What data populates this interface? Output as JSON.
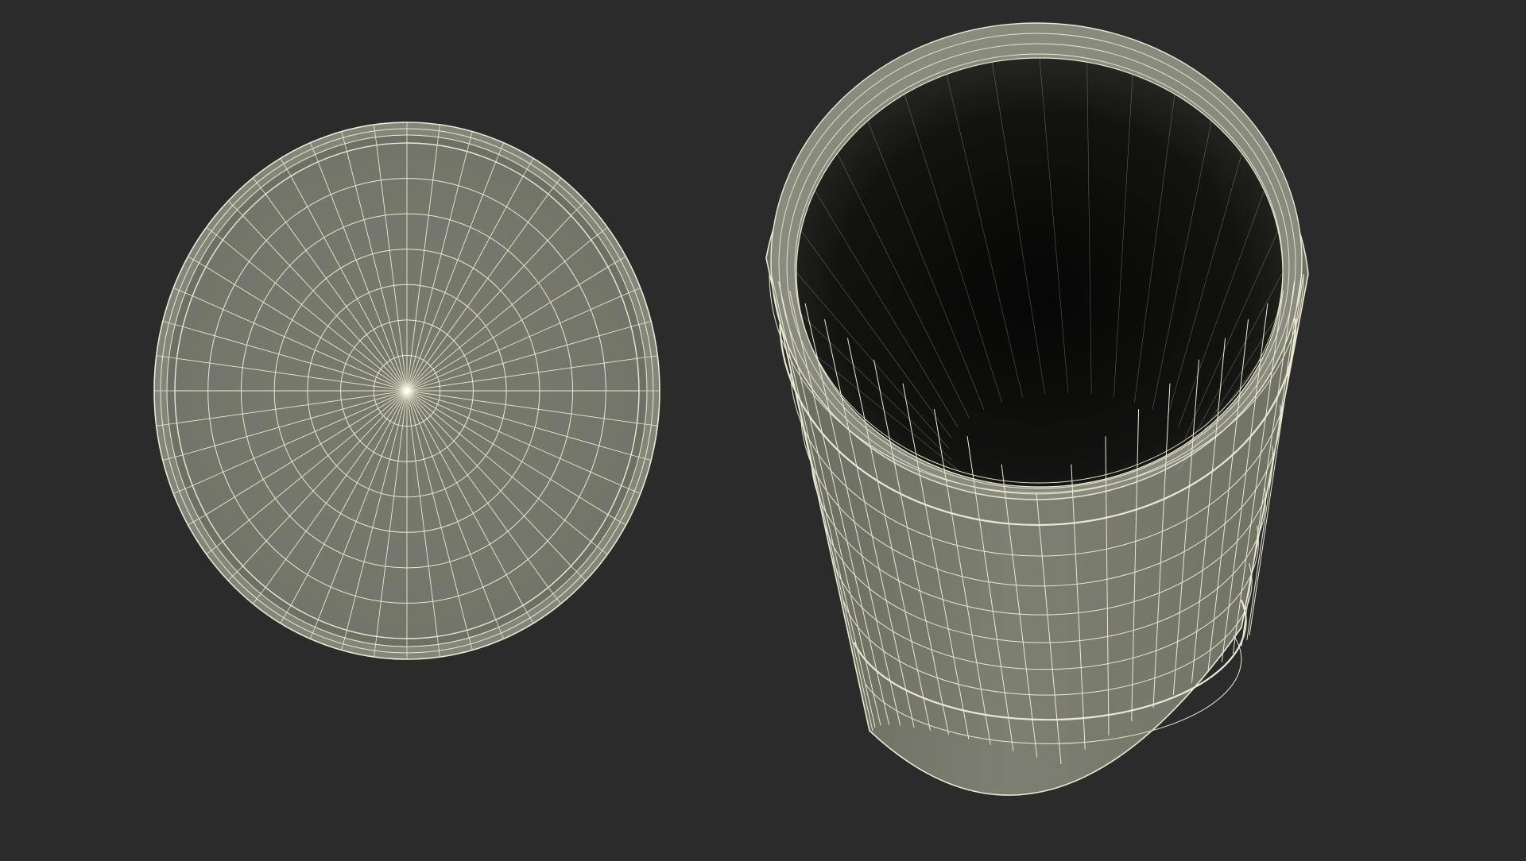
{
  "scene": {
    "background_color": "#2b2b2b",
    "mesh_fill_color": "#7b7b6f",
    "wire_color": "#ebe9d3",
    "interior_color": "#0f100e",
    "objects": [
      {
        "name": "lid",
        "render_mode": "wireframe-on-shaded"
      },
      {
        "name": "container-body",
        "render_mode": "wireframe-on-shaded"
      }
    ]
  }
}
